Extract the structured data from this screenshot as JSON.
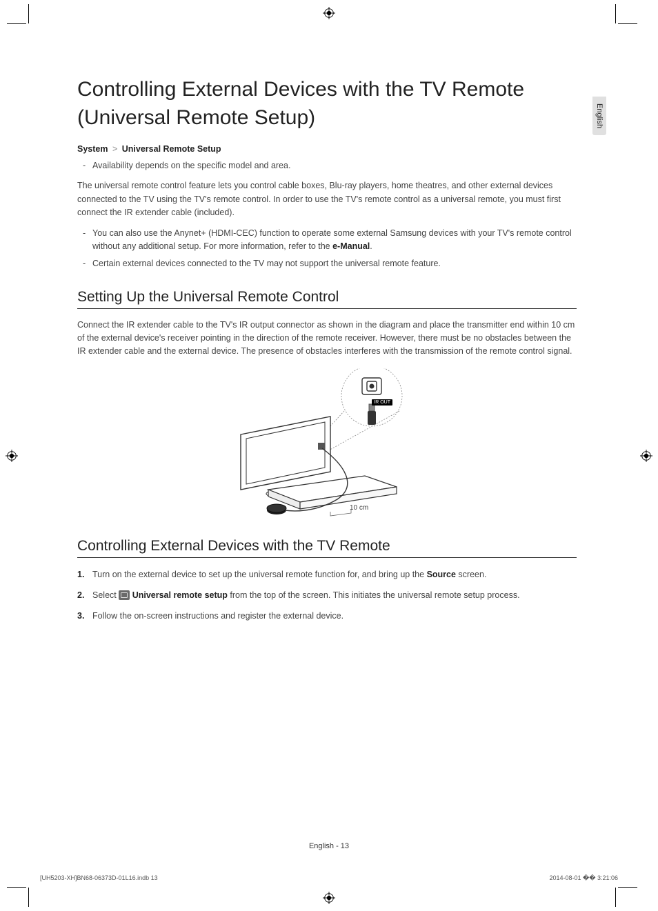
{
  "side_tab": "English",
  "title": "Controlling External Devices with the TV Remote (Universal Remote Setup)",
  "breadcrumb": {
    "a": "System",
    "sep": ">",
    "b": "Universal Remote Setup"
  },
  "bullets_top": [
    "Availability depends on the specific model and area."
  ],
  "para_intro": "The universal remote control feature lets you control cable boxes, Blu-ray players, home theatres, and other external devices connected to the TV using the TV's remote control. In order to use the TV's remote control as a universal remote, you must first connect the IR extender cable (included).",
  "bullets_intro": [
    {
      "pre": "You can also use the Anynet+ (HDMI-CEC) function to operate some external Samsung devices with your TV's remote control without any additional setup. For more information, refer to the ",
      "bold": "e-Manual",
      "post": "."
    },
    {
      "pre": "Certain external devices connected to the TV may not support the universal remote feature.",
      "bold": "",
      "post": ""
    }
  ],
  "h2_setup": "Setting Up the Universal Remote Control",
  "para_setup": "Connect the IR extender cable to the TV's IR output connector as shown in the diagram and place the transmitter end within 10 cm of the external device's receiver pointing in the direction of the remote receiver. However, there must be no obstacles between the IR extender cable and the external device. The presence of obstacles interferes with the transmission of the remote control signal.",
  "diagram": {
    "ir_label": "IR OUT",
    "distance": "10 cm"
  },
  "h2_control": "Controlling External Devices with the TV Remote",
  "steps": [
    {
      "pre": "Turn on the external device to set up the universal remote function for, and bring up the ",
      "bold": "Source",
      "post": " screen."
    },
    {
      "pre": "Select ",
      "icon": true,
      "bold": "Universal remote setup",
      "post": " from the top of the screen. This initiates the universal remote setup process."
    },
    {
      "pre": "Follow the on-screen instructions and register the external device.",
      "bold": "",
      "post": ""
    }
  ],
  "footer_page": "English - 13",
  "footer_file": "[UH5203-XH]BN68-06373D-01L16.indb   13",
  "footer_time": "2014-08-01   �� 3:21:06"
}
